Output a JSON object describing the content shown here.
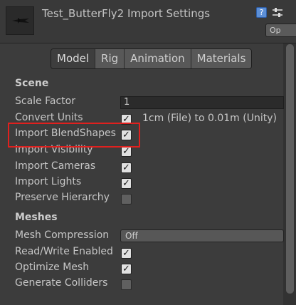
{
  "header": {
    "title": "Test_ButterFly2 Import Settings",
    "open_label": "Op",
    "help_glyph": "?",
    "thumbnail_icon": "butterfly-model-icon",
    "settings_icon": "settings-sliders-icon"
  },
  "tabs": [
    {
      "label": "Model",
      "active": true
    },
    {
      "label": "Rig",
      "active": false
    },
    {
      "label": "Animation",
      "active": false
    },
    {
      "label": "Materials",
      "active": false
    }
  ],
  "scene": {
    "heading": "Scene",
    "scale_factor": {
      "label": "Scale Factor",
      "value": "1"
    },
    "convert_units": {
      "label": "Convert Units",
      "checked": true,
      "info": "1cm (File) to 0.01m (Unity)"
    },
    "import_blendshapes": {
      "label": "Import BlendShapes",
      "checked": true
    },
    "import_visibility": {
      "label": "Import Visibility",
      "checked": true
    },
    "import_cameras": {
      "label": "Import Cameras",
      "checked": true
    },
    "import_lights": {
      "label": "Import Lights",
      "checked": true
    },
    "preserve_hierarchy": {
      "label": "Preserve Hierarchy",
      "checked": false
    }
  },
  "meshes": {
    "heading": "Meshes",
    "mesh_compression": {
      "label": "Mesh Compression",
      "value": "Off"
    },
    "read_write_enabled": {
      "label": "Read/Write Enabled",
      "checked": true
    },
    "optimize_mesh": {
      "label": "Optimize Mesh",
      "checked": true
    },
    "generate_colliders": {
      "label": "Generate Colliders",
      "checked": false
    }
  },
  "check_glyph": "✓",
  "colors": {
    "highlight": "#e0201e",
    "background": "#3c3c3c"
  }
}
